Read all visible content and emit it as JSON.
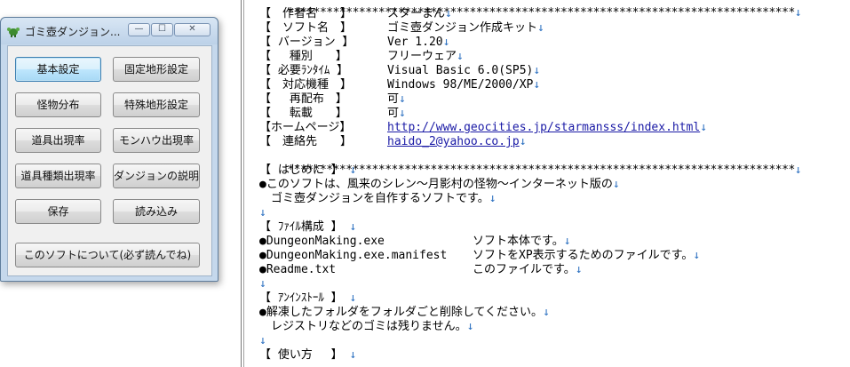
{
  "window": {
    "title": "ゴミ壺ダンジョン...",
    "min_glyph": "—",
    "max_glyph": "☐",
    "close_glyph": "✕",
    "buttons": [
      {
        "label": "基本設定"
      },
      {
        "label": "固定地形設定"
      },
      {
        "label": "怪物分布"
      },
      {
        "label": "特殊地形設定"
      },
      {
        "label": "道具出現率"
      },
      {
        "label": "モンハウ出現率"
      },
      {
        "label": "道具種類出現率"
      },
      {
        "label": "ダンジョンの説明"
      },
      {
        "label": "保存"
      },
      {
        "label": "読み込み"
      },
      {
        "label": "このソフトについて(必ず読んでね)"
      }
    ]
  },
  "editor": {
    "arrow": "↓",
    "stars": "******************************************************************************",
    "info": [
      {
        "key": "【　作者名　　】",
        "value": "スターまん"
      },
      {
        "key": "【　ソフト名　】",
        "value": "ゴミ壺ダンジョン作成キット"
      },
      {
        "key": "【 バージョン 】",
        "value": "Ver 1.20"
      },
      {
        "key": "【　 種別　　】",
        "value": "フリーウェア"
      },
      {
        "key": "【 必要ﾗﾝﾀｲﾑ 】",
        "value": "Visual Basic 6.0(SP5)"
      },
      {
        "key": "【　対応機種　】",
        "value": "Windows 98/ME/2000/XP"
      },
      {
        "key": "【　 再配布　】",
        "value": "可"
      },
      {
        "key": "【　 転載　　】",
        "value": "可"
      },
      {
        "key": "【ホームページ】",
        "value": "http://www.geocities.jp/starmansss/index.html"
      },
      {
        "key": "【　連絡先　　】",
        "value": "haido_2@yahoo.co.jp"
      }
    ],
    "intro_heading": "【 はじめに 】",
    "intro_1": "●このソフトは、風来のシレン～月影村の怪物～インターネット版の",
    "intro_2": "　ゴミ壺ダンジョンを自作するソフトです。",
    "files_heading": "【 ﾌｧｲﾙ構成 】",
    "files": [
      {
        "name": "●DungeonMaking.exe",
        "desc": "ソフト本体です。"
      },
      {
        "name": "●DungeonMaking.exe.manifest",
        "desc": "ソフトをXP表示するためのファイルです。"
      },
      {
        "name": "●Readme.txt",
        "desc": "このファイルです。"
      }
    ],
    "uninstall_heading": "【 ｱﾝｲﾝｽﾄｰﾙ 】",
    "uninstall_1": "●解凍したフォルダをフォルダごと削除してください。",
    "uninstall_2": "　レジストリなどのゴミは残りません。",
    "usage_heading": "【 使い方 　】"
  }
}
